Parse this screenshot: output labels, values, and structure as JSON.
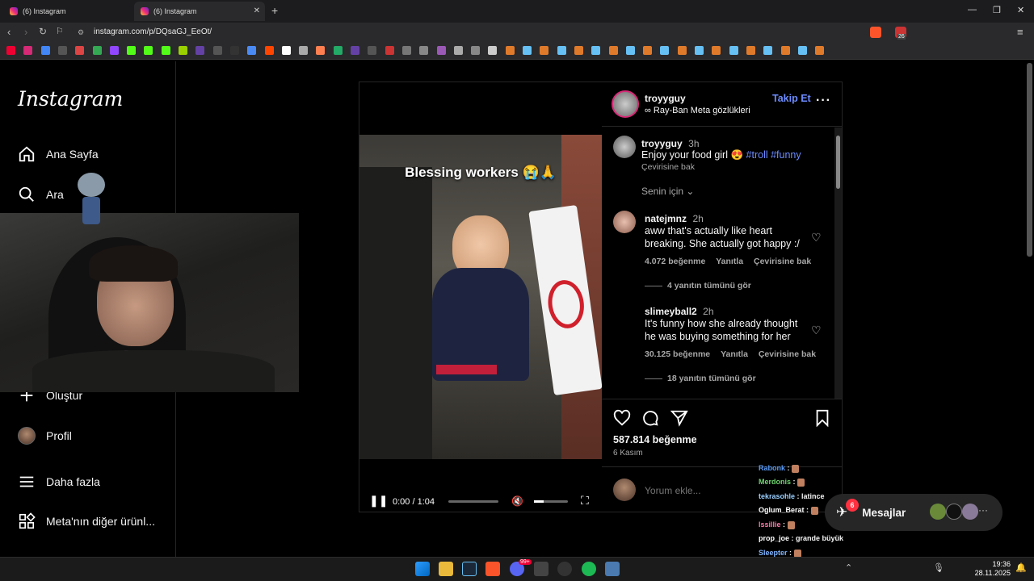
{
  "browser": {
    "tabs": [
      {
        "title": "(6) Instagram",
        "active": false
      },
      {
        "title": "(6) Instagram",
        "active": true
      }
    ],
    "url": "instagram.com/p/DQsaGJ_EeOt/",
    "extension_badge": "26"
  },
  "sidebar": {
    "logo": "Instagram",
    "items": [
      {
        "label": "Ana Sayfa",
        "icon": "home-icon"
      },
      {
        "label": "Ara",
        "icon": "search-icon"
      },
      {
        "label": "Oluştur",
        "icon": "plus-icon"
      },
      {
        "label": "Profil",
        "icon": "avatar"
      },
      {
        "label": "Daha fazla",
        "icon": "menu-icon"
      },
      {
        "label": "Meta'nın diğer ürünl...",
        "icon": "apps-icon"
      }
    ]
  },
  "post": {
    "author": "troyyguy",
    "follow": "Takip Et",
    "subtitle": "Ray-Ban Meta gözlükleri",
    "video_caption": "Blessing workers 😭🙏",
    "video_time": "0:00 / 1:04",
    "caption": {
      "user": "troyyguy",
      "time": "3h",
      "text": "Enjoy your food girl 😍",
      "tags": "#troll #funny",
      "translate": "Çevirisine bak"
    },
    "for_you": "Senin için",
    "comments": [
      {
        "user": "natejmnz",
        "time": "2h",
        "text": "aww that's actually like heart breaking. She actually got happy :/",
        "likes": "4.072 beğenme",
        "reply": "Yanıtla",
        "translate": "Çevirisine bak",
        "replies": "4 yanıtın tümünü gör"
      },
      {
        "user": "slimeyball2",
        "time": "2h",
        "text": "It's funny how she already thought he was buying something for her",
        "likes": "30.125 beğenme",
        "reply": "Yanıtla",
        "translate": "Çevirisine bak",
        "replies": "18 yanıtın tümünü gör"
      }
    ],
    "likes": "587.814 beğenme",
    "date": "6 Kasım",
    "comment_placeholder": "Yorum ekle..."
  },
  "chat": [
    {
      "user": "Rabonk",
      "msg": "",
      "color": "#5b9bf5"
    },
    {
      "user": "Merdonis",
      "msg": "",
      "color": "#6fd36f"
    },
    {
      "user": "tekrasohle",
      "msg": "latince",
      "color": "#9ad0ff"
    },
    {
      "user": "Oglum_Berat",
      "msg": "",
      "color": "#ffffff"
    },
    {
      "user": "lssillie",
      "msg": "",
      "color": "#ff7aa8"
    },
    {
      "user": "prop_joe",
      "msg": "grande büyük",
      "color": "#ffffff"
    },
    {
      "user": "Sleepter",
      "msg": "",
      "color": "#7fb4ff"
    }
  ],
  "messages": {
    "label": "Mesajlar",
    "badge": "6"
  },
  "taskbar": {
    "time": "19:36",
    "date": "28.11.2025",
    "discord_badge": "99+"
  },
  "colors": {
    "accent": "#4a5df9",
    "follow": "#6d8cff",
    "background": "#000000"
  }
}
